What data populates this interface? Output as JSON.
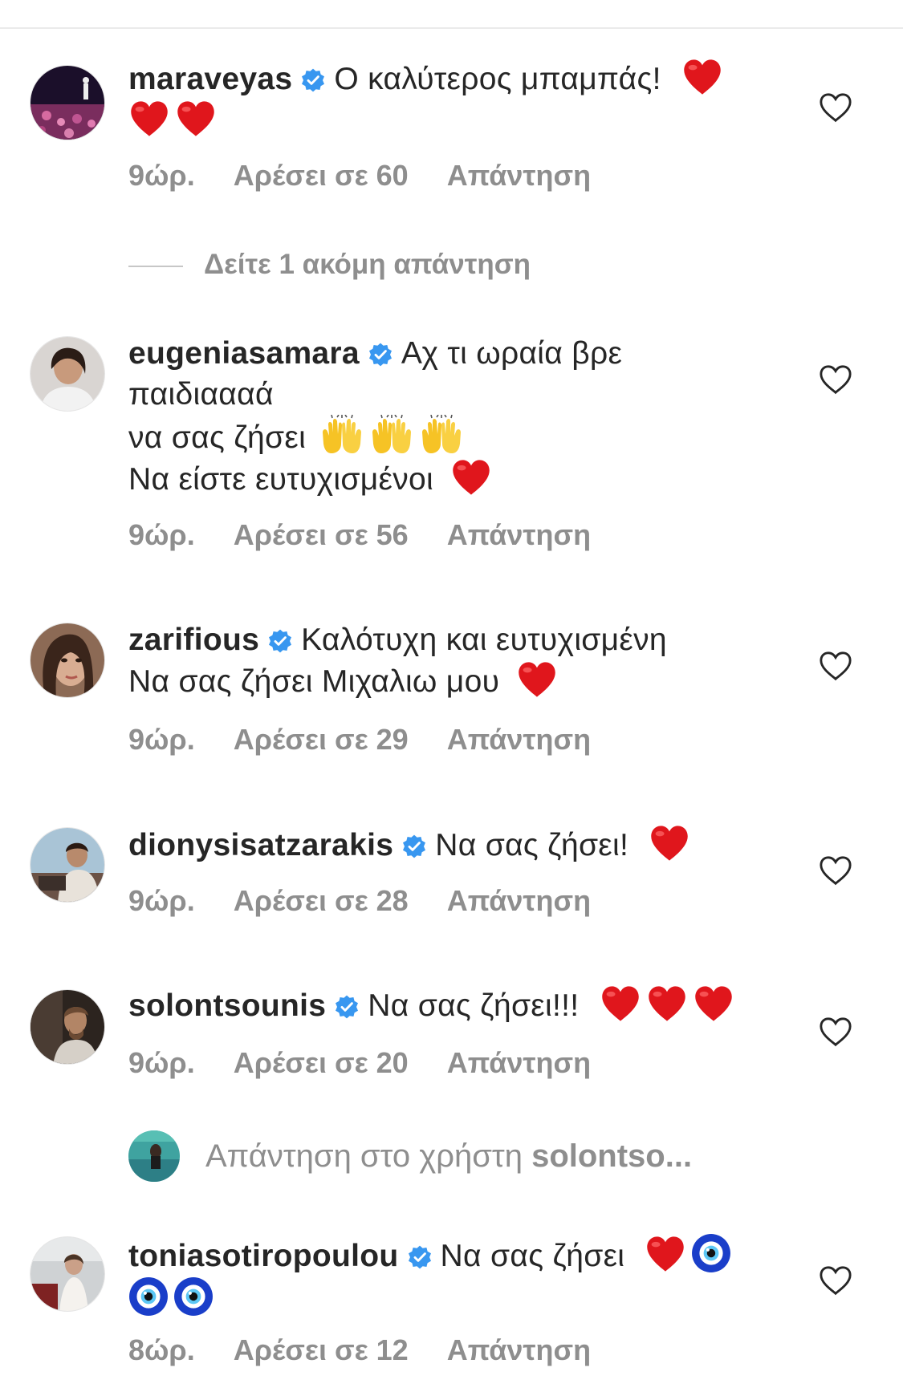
{
  "comments": [
    {
      "username": "maraveyas",
      "text": "Ο καλύτερος μπαμπάς!",
      "time": "9ώρ.",
      "likes": "Αρέσει σε 60",
      "reply": "Απάντηση"
    },
    {
      "username": "eugeniasamara",
      "text1": "Αχ τι ωραία βρε",
      "text2": "παιδιαααά",
      "text3": "να σας ζήσει",
      "text4": "Να είστε ευτυχισμένοι",
      "time": "9ώρ.",
      "likes": "Αρέσει σε 56",
      "reply": "Απάντηση"
    },
    {
      "username": "zarifious",
      "text1": "Καλότυχη και ευτυχισμένη",
      "text2": "Να σας ζήσει Μιχαλιω μου",
      "time": "9ώρ.",
      "likes": "Αρέσει σε 29",
      "reply": "Απάντηση"
    },
    {
      "username": "dionysisatzarakis",
      "text": "Να σας ζήσει!",
      "time": "9ώρ.",
      "likes": "Αρέσει σε 28",
      "reply": "Απάντηση"
    },
    {
      "username": "solontsounis",
      "text": "Να σας ζήσει!!!",
      "time": "9ώρ.",
      "likes": "Αρέσει σε 20",
      "reply": "Απάντηση"
    },
    {
      "username": "toniasotiropoulou",
      "text": "Να σας ζήσει",
      "time": "8ώρ.",
      "likes": "Αρέσει σε 12",
      "reply": "Απάντηση"
    }
  ],
  "view_more_replies": "Δείτε 1 ακόμη απάντηση",
  "reply_bar": {
    "prefix": "Απάντηση στο χρήστη",
    "target": "solontso..."
  },
  "colors": {
    "text": "#262626",
    "meta": "#8e8e8e",
    "verified": "#3897f0",
    "heart_emoji": "#e0161c"
  },
  "icons": {
    "verified": "verified-badge-icon",
    "like": "heart-outline-icon",
    "red_heart": "red-heart-emoji",
    "raised_hands": "raising-hands-emoji",
    "evil_eye": "nazar-amulet-emoji"
  }
}
